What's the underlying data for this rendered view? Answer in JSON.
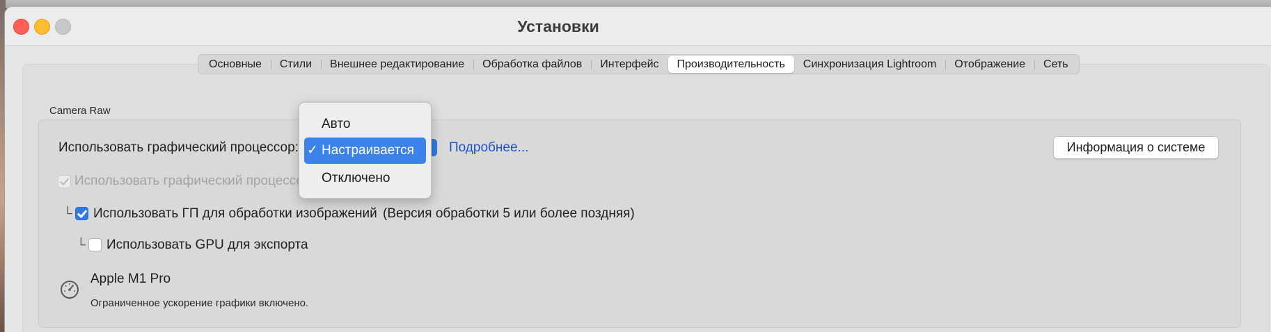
{
  "window": {
    "title": "Установки"
  },
  "tabs": [
    {
      "label": "Основные",
      "active": false
    },
    {
      "label": "Стили",
      "active": false
    },
    {
      "label": "Внешнее редактирование",
      "active": false
    },
    {
      "label": "Обработка файлов",
      "active": false
    },
    {
      "label": "Интерфейс",
      "active": false
    },
    {
      "label": "Производительность",
      "active": true
    },
    {
      "label": "Синхронизация Lightroom",
      "active": false
    },
    {
      "label": "Отображение",
      "active": false
    },
    {
      "label": "Сеть",
      "active": false
    }
  ],
  "camera_raw": {
    "group_label": "Camera Raw",
    "gpu_label": "Использовать графический процессор:",
    "more_link": "Подробнее...",
    "system_info_button": "Информация о системе",
    "disabled_option": "Использовать графический процессо",
    "image_processing_label": "Использовать ГП для обработки изображений",
    "image_processing_note": "(Версия обработки 5 или более поздняя)",
    "image_processing_checked": true,
    "export_label": "Использовать GPU для экспорта",
    "export_checked": false,
    "tree_glyph": "└",
    "gpu_name": "Apple M1 Pro",
    "gpu_status": "Ограниченное ускорение графики включено.",
    "gpu_icon": "speedometer-icon"
  },
  "dropdown": {
    "check_glyph": "✓",
    "options": [
      {
        "label": "Авто",
        "selected": false
      },
      {
        "label": "Настраивается",
        "selected": true
      },
      {
        "label": "Отключено",
        "selected": false
      }
    ]
  },
  "colors": {
    "accent": "#3b82ea",
    "link": "#2052c8",
    "close": "#ff5f57",
    "minimize": "#febc2e"
  }
}
